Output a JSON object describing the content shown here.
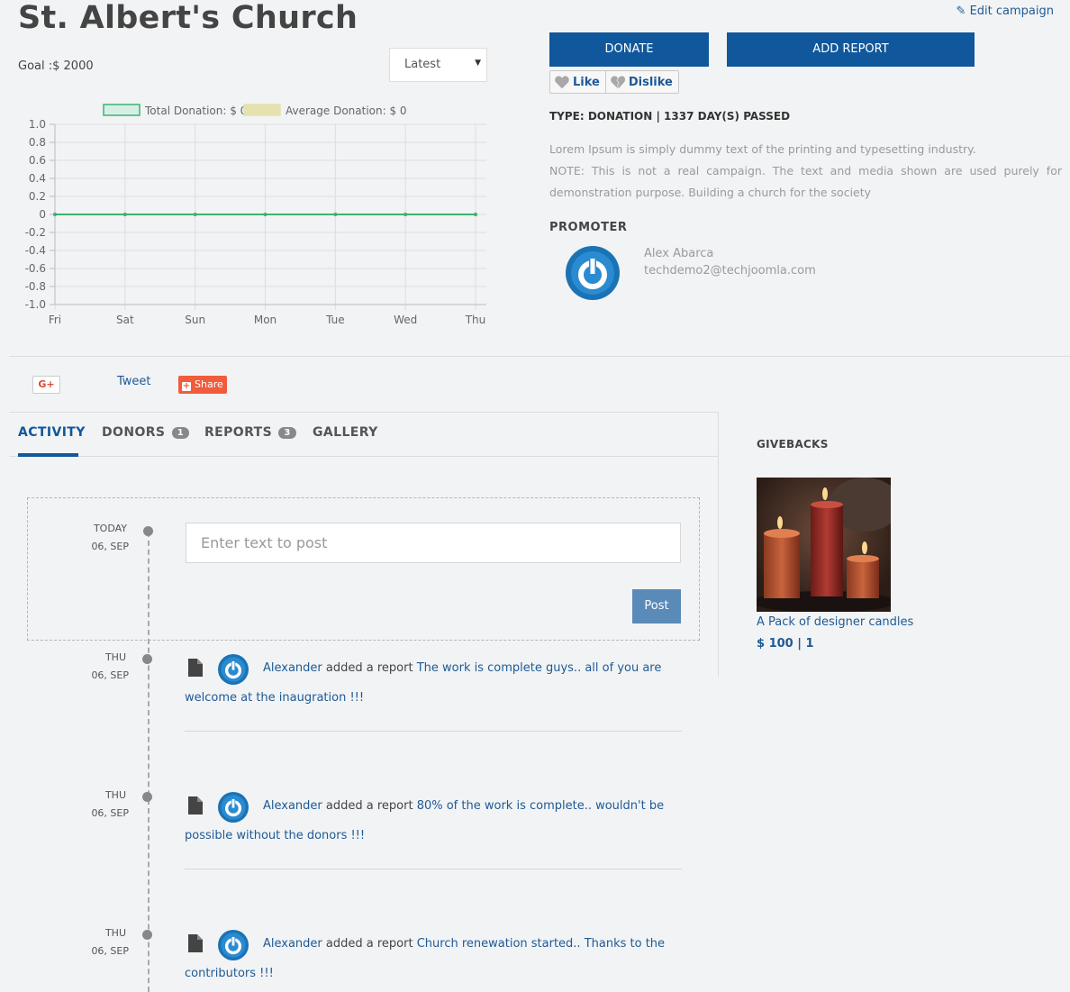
{
  "campaign": {
    "title": "St. Albert's Church",
    "goal": "Goal :$ 2000",
    "sort_select": "Latest",
    "edit_link": "Edit campaign",
    "donate_label": "DONATE",
    "add_report_label": "ADD REPORT",
    "like_label": "Like",
    "dislike_label": "Dislike",
    "type_line": "TYPE: DONATION | 1337 DAY(S) PASSED",
    "description": "Lorem Ipsum is simply dummy text of the printing and typesetting industry.",
    "note": "NOTE: This is not a real campaign. The text and media shown are used purely for demonstration purpose. Building a church for the society",
    "promoter_heading": "PROMOTER",
    "promoter_name": "Alex Abarca",
    "promoter_email": "techdemo2@techjoomla.com"
  },
  "chart_data": {
    "type": "line",
    "categories": [
      "Fri",
      "Sat",
      "Sun",
      "Mon",
      "Tue",
      "Wed",
      "Thu"
    ],
    "series": [
      {
        "name": "Total Donation: $ 0",
        "values": [
          0,
          0,
          0,
          0,
          0,
          0,
          0
        ],
        "color": "#3cb371"
      },
      {
        "name": "Average Donation: $ 0",
        "values": [
          0,
          0,
          0,
          0,
          0,
          0,
          0
        ],
        "color": "#d4cf7a"
      }
    ],
    "yticks": [
      "1.0",
      "0.8",
      "0.6",
      "0.4",
      "0.2",
      "0",
      "-0.2",
      "-0.4",
      "-0.6",
      "-0.8",
      "-1.0"
    ],
    "ylim": [
      -1,
      1
    ],
    "legend": "top",
    "grid": true
  },
  "social": {
    "gplus": "G+",
    "tweet": "Tweet",
    "share": "Share"
  },
  "tabs": [
    {
      "label": "ACTIVITY",
      "badge": ""
    },
    {
      "label": "DONORS",
      "badge": "1"
    },
    {
      "label": "REPORTS",
      "badge": "3"
    },
    {
      "label": "GALLERY",
      "badge": ""
    }
  ],
  "post": {
    "date_top": "TODAY",
    "date_bottom": "06, SEP",
    "placeholder": "Enter text to post",
    "button": "Post"
  },
  "activities": [
    {
      "day": "THU",
      "date": "06, SEP",
      "name": "Alexander",
      "action": " added a report ",
      "link": "The work is complete guys.. all of you are welcome at the inaugration !!!"
    },
    {
      "day": "THU",
      "date": "06, SEP",
      "name": "Alexander",
      "action": " added a report ",
      "link": "80% of the work is complete.. wouldn't be possible without the donors !!!"
    },
    {
      "day": "THU",
      "date": "06, SEP",
      "name": "Alexander",
      "action": " added a report ",
      "link": "Church renewation started.. Thanks to the contributors !!!"
    }
  ],
  "givebacks": {
    "title": "GIVEBACKS",
    "item_name": "A Pack of designer candles",
    "item_price": "$ 100 | 1"
  },
  "icons": [
    "pencil-icon",
    "heart-icon",
    "broken-heart-icon",
    "document-icon",
    "power-avatar-icon"
  ]
}
